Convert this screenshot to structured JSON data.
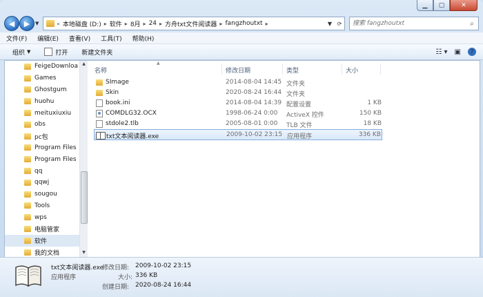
{
  "address": {
    "crumbs": [
      "本地磁盘 (D:)",
      "软件",
      "8月",
      "24",
      "方舟txt文件阅读器",
      "fangzhoutxt"
    ],
    "prefix": "«"
  },
  "search": {
    "placeholder": "搜索 fangzhoutxt"
  },
  "menu": [
    "文件(F)",
    "编辑(E)",
    "查看(V)",
    "工具(T)",
    "帮助(H)"
  ],
  "toolbar": {
    "organize": "组织",
    "open": "打开",
    "new_folder": "新建文件夹"
  },
  "sidebar": {
    "items": [
      "FeigeDownloa",
      "Games",
      "Ghostgum",
      "huohu",
      "meituxiuxiu",
      "obs",
      "pc包",
      "Program Files",
      "Program Files",
      "qq",
      "qqwj",
      "sougou",
      "Tools",
      "wps",
      "电脑管家",
      "软件",
      "我的文档"
    ],
    "selected_index": 15
  },
  "columns": {
    "name": "名称",
    "modified": "修改日期",
    "type": "类型",
    "size": "大小"
  },
  "files": [
    {
      "name": "SImage",
      "modified": "2014-08-04 14:45",
      "type": "文件夹",
      "size": "",
      "icon": "folder-icon"
    },
    {
      "name": "Skin",
      "modified": "2020-08-24 16:44",
      "type": "文件夹",
      "size": "",
      "icon": "folder-icon"
    },
    {
      "name": "book.ini",
      "modified": "2014-08-04 14:39",
      "type": "配置设置",
      "size": "1 KB",
      "icon": "ini-file-icon"
    },
    {
      "name": "COMDLG32.OCX",
      "modified": "1998-06-24 0:00",
      "type": "ActiveX 控件",
      "size": "150 KB",
      "icon": "ocx-file-icon"
    },
    {
      "name": "stdole2.tlb",
      "modified": "2005-08-01 0:00",
      "type": "TLB 文件",
      "size": "18 KB",
      "icon": "tlb-file-icon"
    },
    {
      "name": "txt文本阅读器.exe",
      "modified": "2009-10-02 23:15",
      "type": "应用程序",
      "size": "336 KB",
      "icon": "book-exe-icon"
    }
  ],
  "selected_file_index": 5,
  "details": {
    "filename": "txt文本阅读器.exe",
    "filetype": "应用程序",
    "modified_label": "修改日期:",
    "modified_value": "2009-10-02 23:15",
    "size_label": "大小:",
    "size_value": "336 KB",
    "created_label": "创建日期:",
    "created_value": "2020-08-24 16:44"
  }
}
